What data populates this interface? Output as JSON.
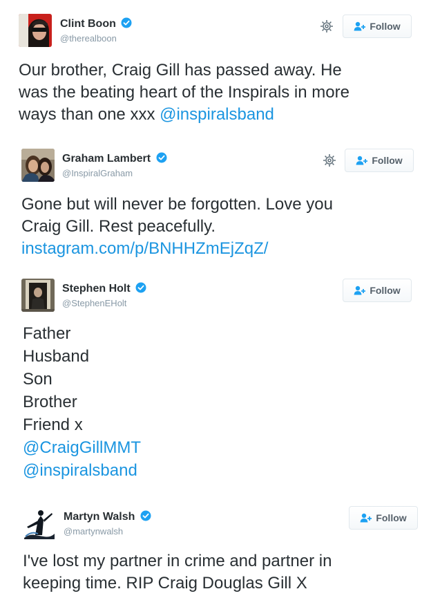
{
  "tweets": [
    {
      "name": "Clint Boon",
      "handle": "@therealboon",
      "follow_label": "Follow",
      "show_gear": true,
      "lines": [
        {
          "text": "Our brother, Craig Gill has passed away. He"
        },
        {
          "text": "was the beating heart of the Inspirals in more"
        },
        {
          "text": "ways than one xxx ",
          "link": "@inspiralsband"
        }
      ]
    },
    {
      "name": "Graham Lambert",
      "handle": "@InspiralGraham",
      "follow_label": "Follow",
      "show_gear": true,
      "lines": [
        {
          "text": "Gone but will never be forgotten. Love you"
        },
        {
          "text": "Craig Gill. Rest peacefully."
        },
        {
          "text": "",
          "link": "instagram.com/p/BNHHZmEjZqZ/"
        }
      ]
    },
    {
      "name": "Stephen Holt",
      "handle": "@StephenEHolt",
      "follow_label": "Follow",
      "show_gear": false,
      "lines": [
        {
          "text": "Father"
        },
        {
          "text": "Husband"
        },
        {
          "text": "Son"
        },
        {
          "text": "Brother"
        },
        {
          "text": "Friend x"
        },
        {
          "text": "",
          "link": "@CraigGillMMT"
        },
        {
          "text": "",
          "link": "@inspiralsband"
        }
      ]
    },
    {
      "name": "Martyn Walsh",
      "handle": "@martynwalsh",
      "follow_label": "Follow",
      "show_gear": false,
      "lines": [
        {
          "text": "I've lost my partner in crime and partner in"
        },
        {
          "text": "keeping time. RIP Craig Douglas Gill X"
        }
      ]
    }
  ],
  "colors": {
    "link": "#1b95e0",
    "verified": "#1da1f2",
    "handle": "#8899a6",
    "text": "#292f33"
  },
  "icons": {
    "verified": "verified-badge-icon",
    "gear": "gear-icon",
    "follow": "add-user-icon"
  }
}
